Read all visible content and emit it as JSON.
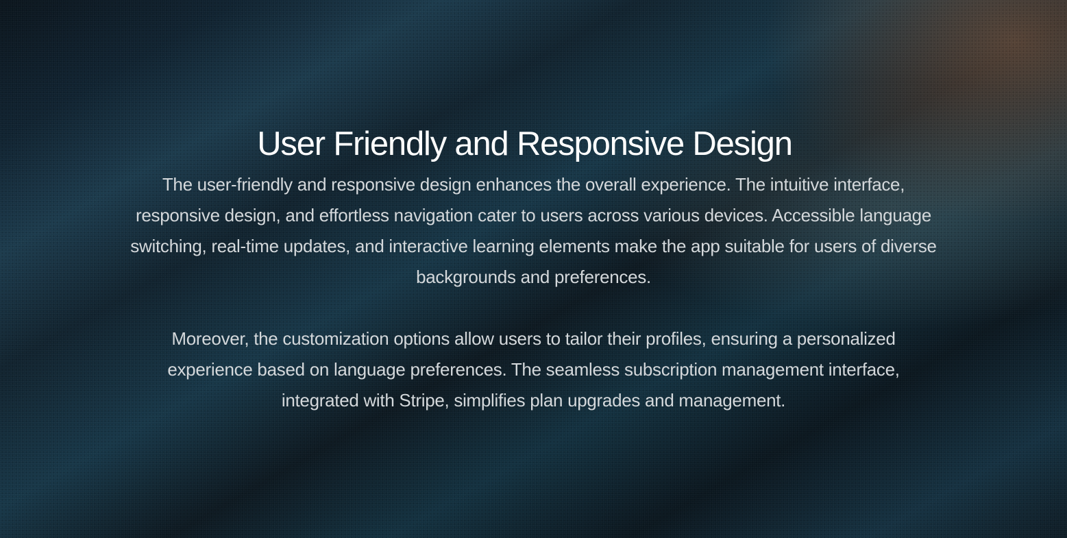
{
  "section": {
    "title": "User Friendly and Responsive Design",
    "paragraphs": [
      "The user-friendly and responsive design enhances the overall experience. The intuitive interface, responsive design, and effortless navigation cater to users across various devices. Accessible language switching, real-time updates, and interactive learning elements make the app suitable for users of diverse backgrounds and preferences.",
      "Moreover, the customization options allow users to tailor their profiles, ensuring a personalized experience based on language preferences. The seamless subscription management interface, integrated with Stripe, simplifies plan upgrades and management."
    ]
  },
  "colors": {
    "heading": "#ffffff",
    "body_text": "#d4d8db",
    "background_primary": "#0f2230",
    "background_accent": "#6e503c"
  }
}
